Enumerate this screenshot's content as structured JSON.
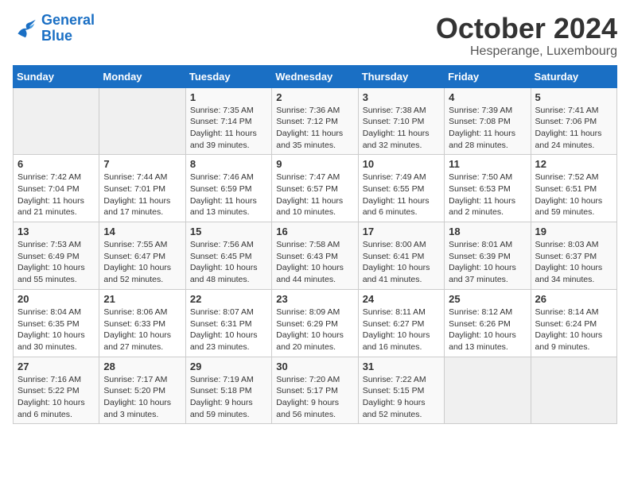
{
  "header": {
    "logo_line1": "General",
    "logo_line2": "Blue",
    "month": "October 2024",
    "location": "Hesperange, Luxembourg"
  },
  "weekdays": [
    "Sunday",
    "Monday",
    "Tuesday",
    "Wednesday",
    "Thursday",
    "Friday",
    "Saturday"
  ],
  "weeks": [
    [
      {
        "day": "",
        "info": ""
      },
      {
        "day": "",
        "info": ""
      },
      {
        "day": "1",
        "info": "Sunrise: 7:35 AM\nSunset: 7:14 PM\nDaylight: 11 hours and 39 minutes."
      },
      {
        "day": "2",
        "info": "Sunrise: 7:36 AM\nSunset: 7:12 PM\nDaylight: 11 hours and 35 minutes."
      },
      {
        "day": "3",
        "info": "Sunrise: 7:38 AM\nSunset: 7:10 PM\nDaylight: 11 hours and 32 minutes."
      },
      {
        "day": "4",
        "info": "Sunrise: 7:39 AM\nSunset: 7:08 PM\nDaylight: 11 hours and 28 minutes."
      },
      {
        "day": "5",
        "info": "Sunrise: 7:41 AM\nSunset: 7:06 PM\nDaylight: 11 hours and 24 minutes."
      }
    ],
    [
      {
        "day": "6",
        "info": "Sunrise: 7:42 AM\nSunset: 7:04 PM\nDaylight: 11 hours and 21 minutes."
      },
      {
        "day": "7",
        "info": "Sunrise: 7:44 AM\nSunset: 7:01 PM\nDaylight: 11 hours and 17 minutes."
      },
      {
        "day": "8",
        "info": "Sunrise: 7:46 AM\nSunset: 6:59 PM\nDaylight: 11 hours and 13 minutes."
      },
      {
        "day": "9",
        "info": "Sunrise: 7:47 AM\nSunset: 6:57 PM\nDaylight: 11 hours and 10 minutes."
      },
      {
        "day": "10",
        "info": "Sunrise: 7:49 AM\nSunset: 6:55 PM\nDaylight: 11 hours and 6 minutes."
      },
      {
        "day": "11",
        "info": "Sunrise: 7:50 AM\nSunset: 6:53 PM\nDaylight: 11 hours and 2 minutes."
      },
      {
        "day": "12",
        "info": "Sunrise: 7:52 AM\nSunset: 6:51 PM\nDaylight: 10 hours and 59 minutes."
      }
    ],
    [
      {
        "day": "13",
        "info": "Sunrise: 7:53 AM\nSunset: 6:49 PM\nDaylight: 10 hours and 55 minutes."
      },
      {
        "day": "14",
        "info": "Sunrise: 7:55 AM\nSunset: 6:47 PM\nDaylight: 10 hours and 52 minutes."
      },
      {
        "day": "15",
        "info": "Sunrise: 7:56 AM\nSunset: 6:45 PM\nDaylight: 10 hours and 48 minutes."
      },
      {
        "day": "16",
        "info": "Sunrise: 7:58 AM\nSunset: 6:43 PM\nDaylight: 10 hours and 44 minutes."
      },
      {
        "day": "17",
        "info": "Sunrise: 8:00 AM\nSunset: 6:41 PM\nDaylight: 10 hours and 41 minutes."
      },
      {
        "day": "18",
        "info": "Sunrise: 8:01 AM\nSunset: 6:39 PM\nDaylight: 10 hours and 37 minutes."
      },
      {
        "day": "19",
        "info": "Sunrise: 8:03 AM\nSunset: 6:37 PM\nDaylight: 10 hours and 34 minutes."
      }
    ],
    [
      {
        "day": "20",
        "info": "Sunrise: 8:04 AM\nSunset: 6:35 PM\nDaylight: 10 hours and 30 minutes."
      },
      {
        "day": "21",
        "info": "Sunrise: 8:06 AM\nSunset: 6:33 PM\nDaylight: 10 hours and 27 minutes."
      },
      {
        "day": "22",
        "info": "Sunrise: 8:07 AM\nSunset: 6:31 PM\nDaylight: 10 hours and 23 minutes."
      },
      {
        "day": "23",
        "info": "Sunrise: 8:09 AM\nSunset: 6:29 PM\nDaylight: 10 hours and 20 minutes."
      },
      {
        "day": "24",
        "info": "Sunrise: 8:11 AM\nSunset: 6:27 PM\nDaylight: 10 hours and 16 minutes."
      },
      {
        "day": "25",
        "info": "Sunrise: 8:12 AM\nSunset: 6:26 PM\nDaylight: 10 hours and 13 minutes."
      },
      {
        "day": "26",
        "info": "Sunrise: 8:14 AM\nSunset: 6:24 PM\nDaylight: 10 hours and 9 minutes."
      }
    ],
    [
      {
        "day": "27",
        "info": "Sunrise: 7:16 AM\nSunset: 5:22 PM\nDaylight: 10 hours and 6 minutes."
      },
      {
        "day": "28",
        "info": "Sunrise: 7:17 AM\nSunset: 5:20 PM\nDaylight: 10 hours and 3 minutes."
      },
      {
        "day": "29",
        "info": "Sunrise: 7:19 AM\nSunset: 5:18 PM\nDaylight: 9 hours and 59 minutes."
      },
      {
        "day": "30",
        "info": "Sunrise: 7:20 AM\nSunset: 5:17 PM\nDaylight: 9 hours and 56 minutes."
      },
      {
        "day": "31",
        "info": "Sunrise: 7:22 AM\nSunset: 5:15 PM\nDaylight: 9 hours and 52 minutes."
      },
      {
        "day": "",
        "info": ""
      },
      {
        "day": "",
        "info": ""
      }
    ]
  ]
}
